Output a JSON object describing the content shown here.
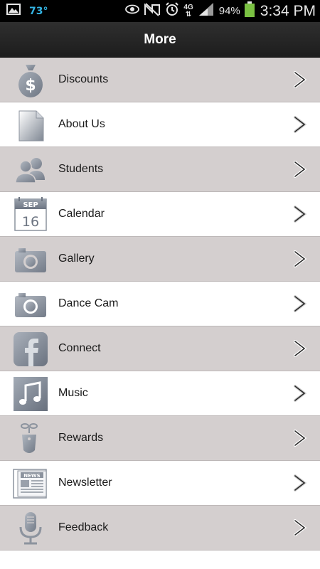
{
  "status_bar": {
    "temperature": "73°",
    "network": "4G",
    "battery": "94%",
    "time": "3:34 PM"
  },
  "header": {
    "title": "More"
  },
  "menu": {
    "items": [
      {
        "label": "Discounts",
        "icon": "money-bag-icon"
      },
      {
        "label": "About Us",
        "icon": "document-icon"
      },
      {
        "label": "Students",
        "icon": "people-icon"
      },
      {
        "label": "Calendar",
        "icon": "calendar-icon",
        "icon_month": "SEP",
        "icon_day": "16"
      },
      {
        "label": "Gallery",
        "icon": "camera-icon"
      },
      {
        "label": "Dance Cam",
        "icon": "camera-icon"
      },
      {
        "label": "Connect",
        "icon": "facebook-icon"
      },
      {
        "label": "Music",
        "icon": "music-note-icon"
      },
      {
        "label": "Rewards",
        "icon": "gift-tag-icon"
      },
      {
        "label": "Newsletter",
        "icon": "newspaper-icon",
        "icon_text": "NEWS"
      },
      {
        "label": "Feedback",
        "icon": "microphone-icon"
      }
    ]
  },
  "colors": {
    "shaded_row": "#d4cfcf",
    "plain_row": "#ffffff",
    "header_bg": "#262626",
    "icon_gray": "#8c939e"
  }
}
